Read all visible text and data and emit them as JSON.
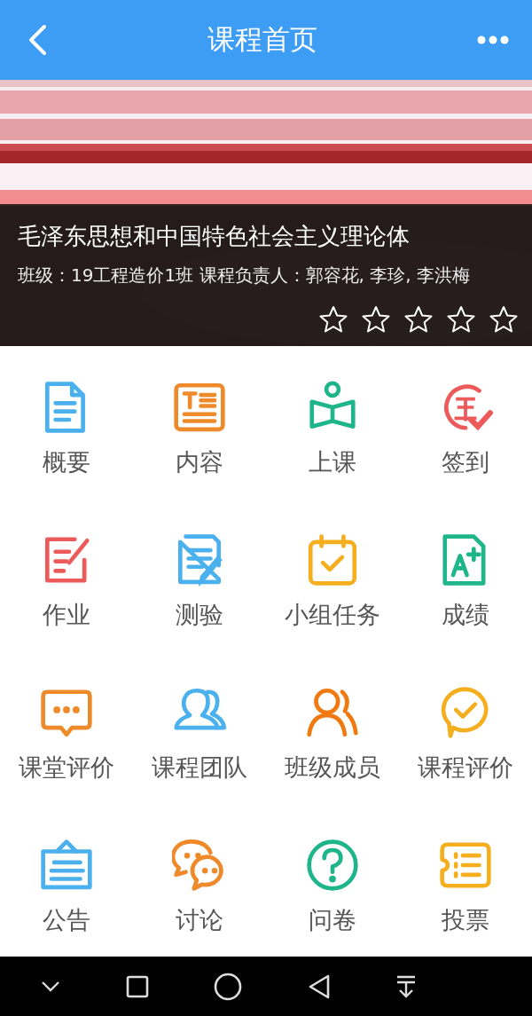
{
  "header": {
    "title": "课程首页"
  },
  "course": {
    "title": "毛泽东思想和中国特色社会主义理论体",
    "info": "班级：19工程造价1班 课程负责人：郭容花, 李珍, 李洪梅",
    "stars": 0
  },
  "menu": [
    {
      "label": "概要"
    },
    {
      "label": "内容"
    },
    {
      "label": "上课"
    },
    {
      "label": "签到"
    },
    {
      "label": "作业"
    },
    {
      "label": "测验"
    },
    {
      "label": "小组任务"
    },
    {
      "label": "成绩"
    },
    {
      "label": "课堂评价"
    },
    {
      "label": "课程团队"
    },
    {
      "label": "班级成员"
    },
    {
      "label": "课程评价"
    },
    {
      "label": "公告"
    },
    {
      "label": "讨论"
    },
    {
      "label": "问卷"
    },
    {
      "label": "投票"
    }
  ]
}
